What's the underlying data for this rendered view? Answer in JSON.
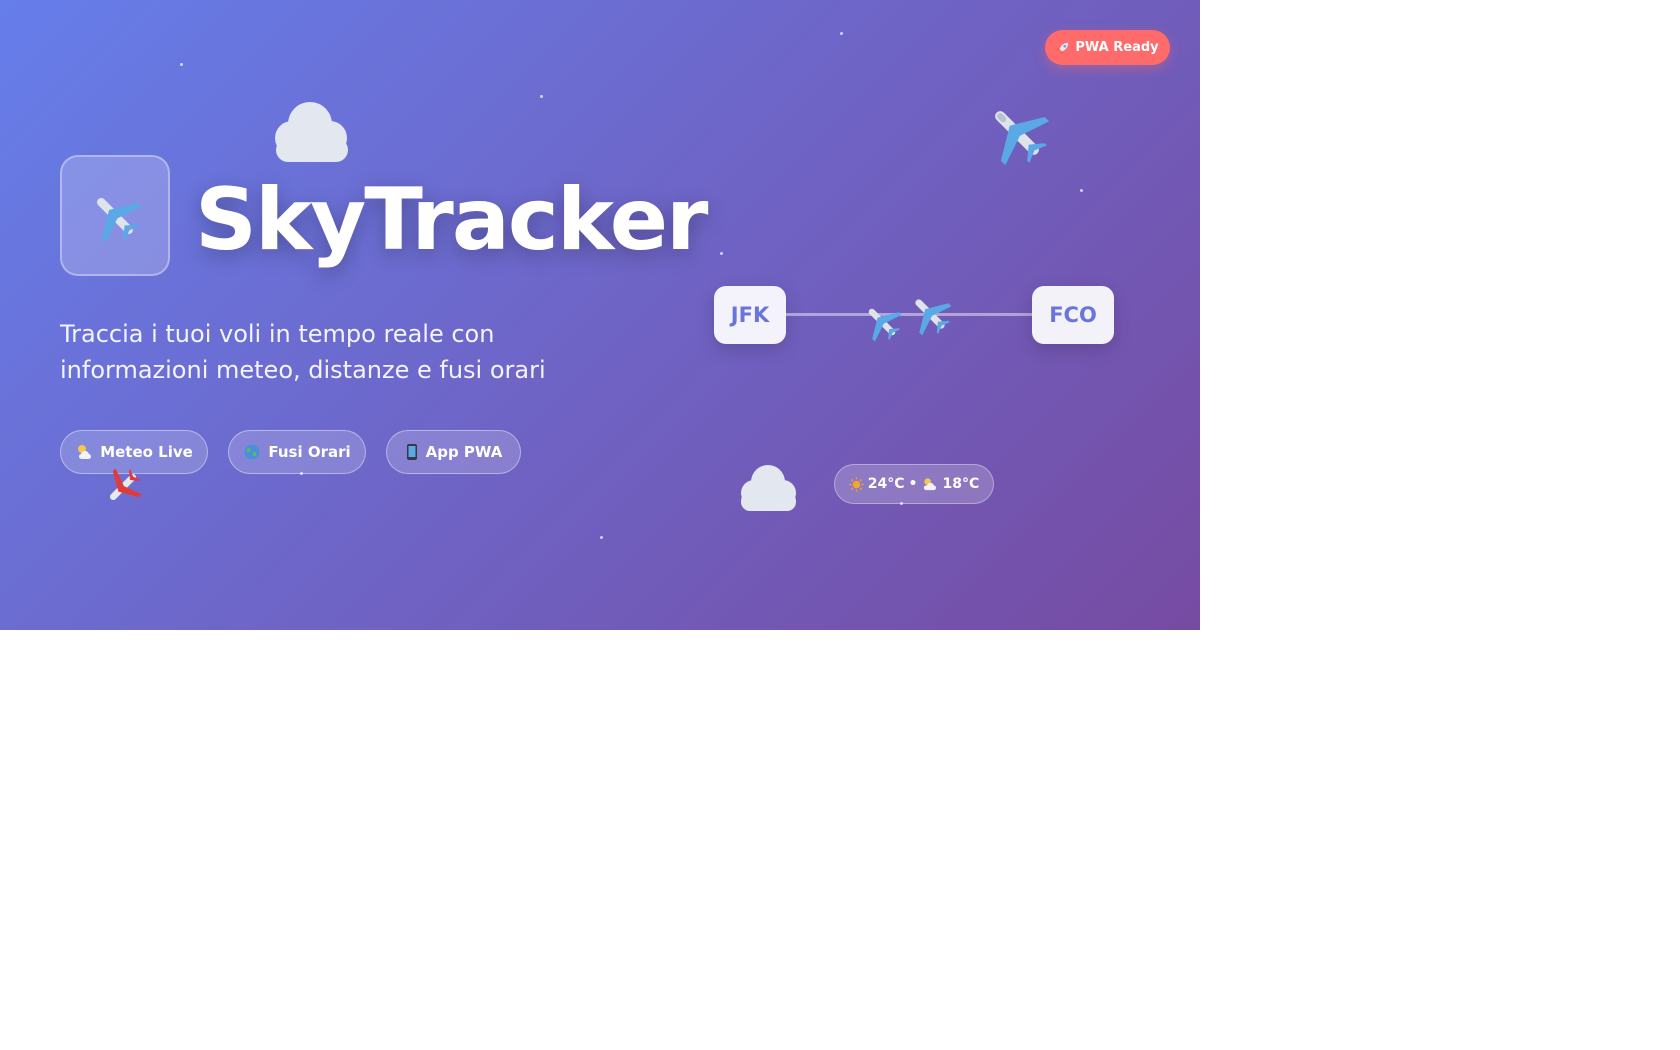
{
  "badge": {
    "label": "PWA Ready",
    "icon": "rocket-icon"
  },
  "brand": {
    "title": "SkyTracker",
    "logo_icon": "airplane-icon"
  },
  "subtitle": "Traccia i tuoi voli in tempo reale con informazioni meteo, distanze e fusi orari",
  "features": [
    {
      "label": "Meteo Live",
      "icon": "sun-behind-cloud-icon"
    },
    {
      "label": "Fusi Orari",
      "icon": "globe-icon"
    },
    {
      "label": "App PWA",
      "icon": "mobile-phone-icon"
    }
  ],
  "route": {
    "from": "JFK",
    "to": "FCO"
  },
  "weather": {
    "origin_temp": "24°C",
    "separator": "•",
    "destination_temp": "18°C"
  },
  "colors": {
    "gradient_start": "#667eea",
    "gradient_end": "#764ba2",
    "badge": "#ff6b6b",
    "airport_text": "#6a75d9"
  }
}
